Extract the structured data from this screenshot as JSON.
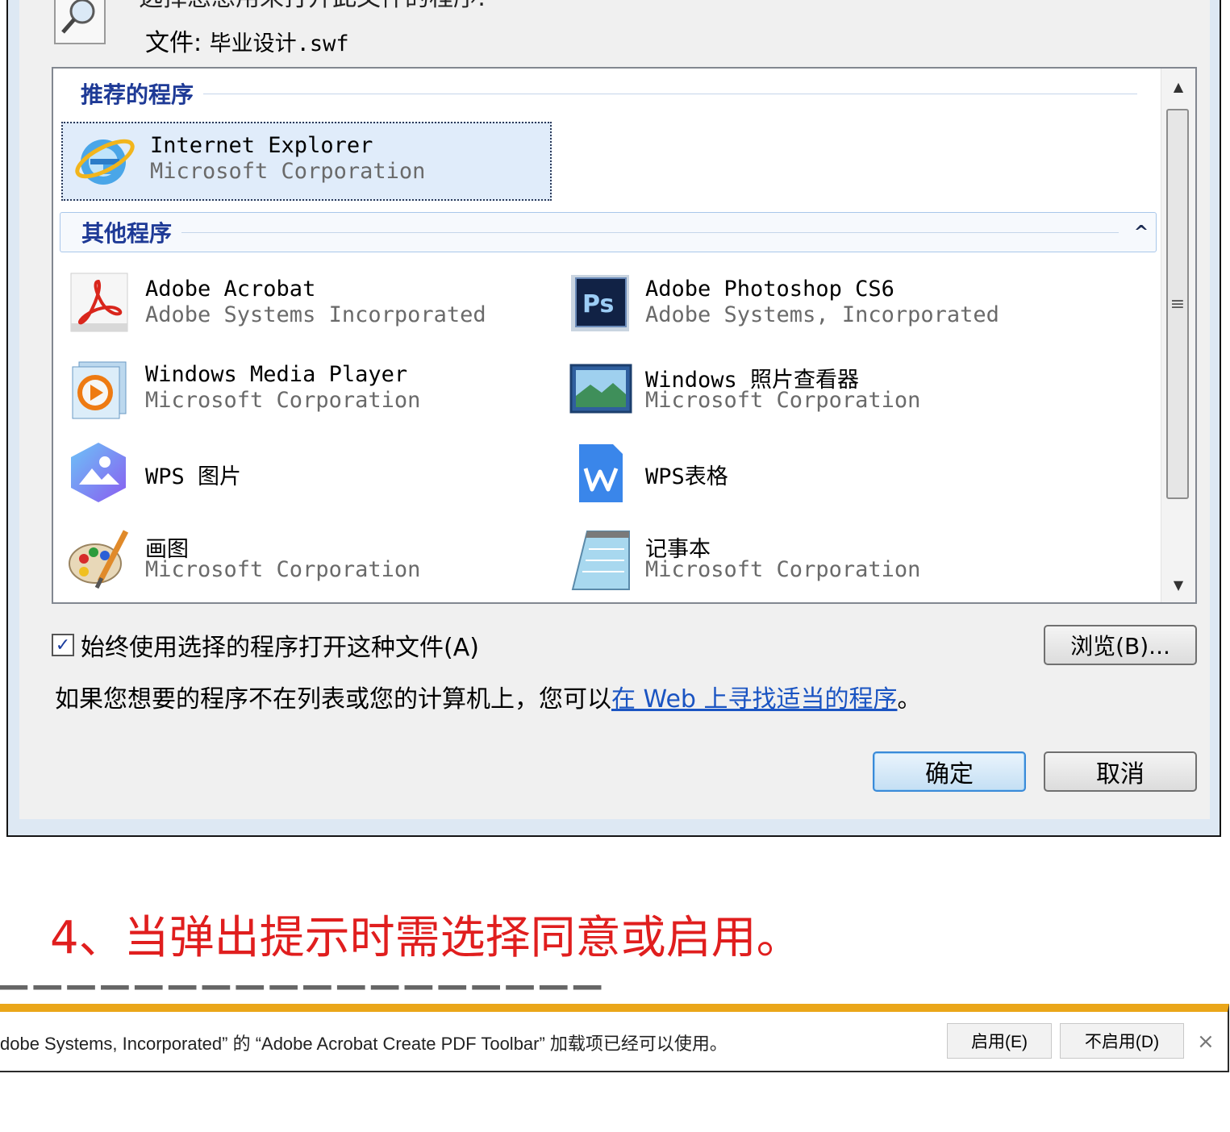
{
  "dialog": {
    "prompt": "选择您想用来打开此文件的程序:",
    "file_label": "文件:",
    "file_name": "毕业设计.swf",
    "recommended_group": "推荐的程序",
    "other_group": "其他程序",
    "recommended": [
      {
        "name": "Internet Explorer",
        "company": "Microsoft Corporation",
        "icon": "internet-explorer-icon"
      }
    ],
    "others": [
      {
        "name": "Adobe Acrobat",
        "company": "Adobe Systems Incorporated",
        "icon": "adobe-acrobat-icon"
      },
      {
        "name": "Adobe Photoshop CS6",
        "company": "Adobe Systems, Incorporated",
        "icon": "photoshop-icon"
      },
      {
        "name": "Windows Media Player",
        "company": "Microsoft Corporation",
        "icon": "media-player-icon"
      },
      {
        "name": "Windows 照片查看器",
        "company": "Microsoft Corporation",
        "icon": "photo-viewer-icon"
      },
      {
        "name": "WPS 图片",
        "company": "",
        "icon": "wps-pictures-icon"
      },
      {
        "name": "WPS表格",
        "company": "",
        "icon": "wps-spreadsheet-icon"
      },
      {
        "name": "画图",
        "company": "Microsoft Corporation",
        "icon": "paint-icon"
      },
      {
        "name": "记事本",
        "company": "Microsoft Corporation",
        "icon": "notepad-icon"
      }
    ],
    "always_use_label": "始终使用选择的程序打开这种文件(A)",
    "always_use_checked": true,
    "browse_label": "浏览(B)...",
    "info_text": "如果您想要的程序不在列表或您的计算机上，您可以",
    "info_link": "在 Web 上寻找适当的程序",
    "info_end": "。",
    "ok_label": "确定",
    "cancel_label": "取消"
  },
  "step_text": "4、当弹出提示时需选择同意或启用。",
  "notification": {
    "message": "dobe Systems, Incorporated” 的 “Adobe Acrobat Create PDF Toolbar” 加载项已经可以使用。",
    "enable_label": "启用(E)",
    "disable_label": "不启用(D)",
    "close_glyph": "×"
  },
  "colors": {
    "step_red": "#e01e1e",
    "notification_bar": "#eaa619",
    "group_title": "#1e3a96",
    "link": "#1a54c2"
  }
}
